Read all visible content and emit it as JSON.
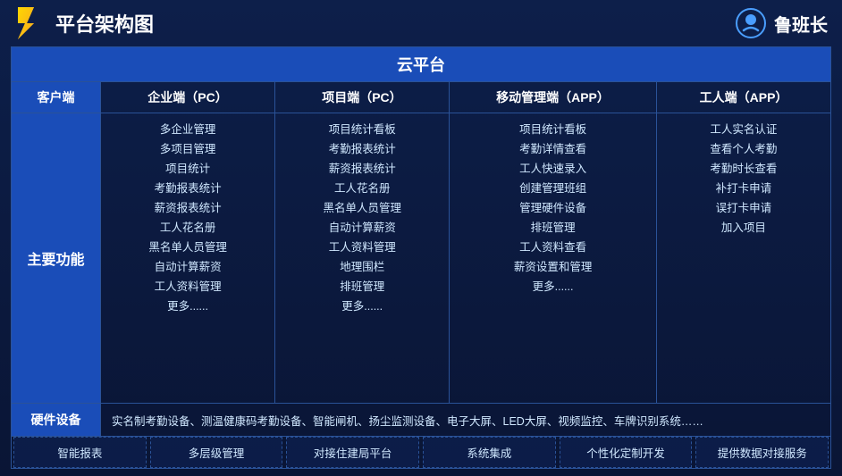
{
  "header": {
    "title": "平台架构图",
    "brand_name": "鲁班长"
  },
  "cloud_platform": "云平台",
  "columns": {
    "client": "客户端",
    "enterprise": "企业端（PC）",
    "project": "项目端（PC）",
    "mobile": "移动管理端（APP）",
    "worker": "工人端（APP）"
  },
  "main_label": "主要功能",
  "hardware_label": "硬件设备",
  "enterprise_items": [
    "多企业管理",
    "多项目管理",
    "项目统计",
    "考勤报表统计",
    "薪资报表统计",
    "工人花名册",
    "黑名单人员管理",
    "自动计算薪资",
    "工人资料管理",
    "更多......"
  ],
  "project_items": [
    "项目统计看板",
    "考勤报表统计",
    "薪资报表统计",
    "工人花名册",
    "黑名单人员管理",
    "自动计算薪资",
    "工人资料管理",
    "地理围栏",
    "排班管理",
    "更多......"
  ],
  "mobile_items": [
    "项目统计看板",
    "考勤详情查看",
    "工人快速录入",
    "创建管理班组",
    "管理硬件设备",
    "排班管理",
    "工人资料查看",
    "薪资设置和管理",
    "更多......"
  ],
  "worker_items": [
    "工人实名认证",
    "查看个人考勤",
    "考勤时长查看",
    "补打卡申请",
    "误打卡申请",
    "加入项目"
  ],
  "hardware_content": "实名制考勤设备、测温健康码考勤设备、智能闸机、扬尘监测设备、电子大屏、LED大屏、视频监控、车牌识别系统……",
  "features": [
    "智能报表",
    "多层级管理",
    "对接住建局平台",
    "系统集成",
    "个性化定制开发",
    "提供数据对接服务"
  ]
}
